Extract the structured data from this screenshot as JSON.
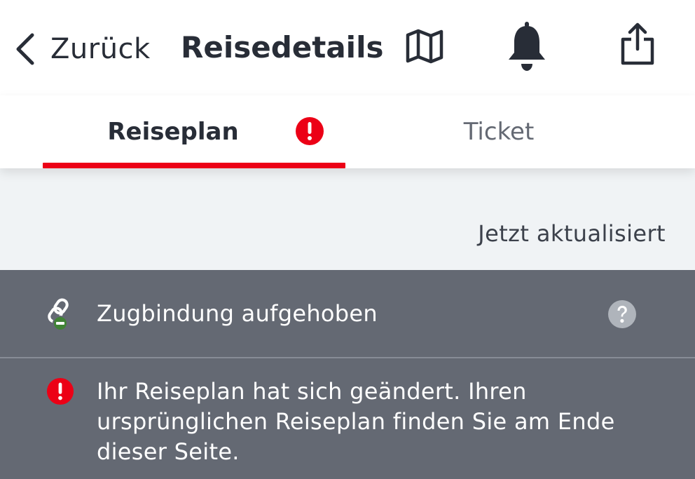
{
  "header": {
    "back_label": "Zurück",
    "title": "Reisedetails",
    "icons": [
      "chevron-left-icon",
      "map-icon",
      "bell-icon",
      "share-icon"
    ]
  },
  "tabs": [
    {
      "label": "Reiseplan",
      "active": true,
      "has_alert": true
    },
    {
      "label": "Ticket",
      "active": false
    }
  ],
  "status": {
    "updated_text": "Jetzt aktualisiert"
  },
  "notices": [
    {
      "icon": "link-icon",
      "text": "Zugbindung aufgehoben",
      "has_help": true
    },
    {
      "icon": "warning-icon",
      "text": "Ihr Reiseplan hat sich geändert. Ihren ursprünglichen Reiseplan finden Sie am Ende dieser Seite."
    }
  ],
  "colors": {
    "accent": "#ec0016",
    "text_primary": "#282d37",
    "notice_background": "#646973",
    "strip_background": "#f0f3f5",
    "link_icon_badge": "#408335"
  }
}
